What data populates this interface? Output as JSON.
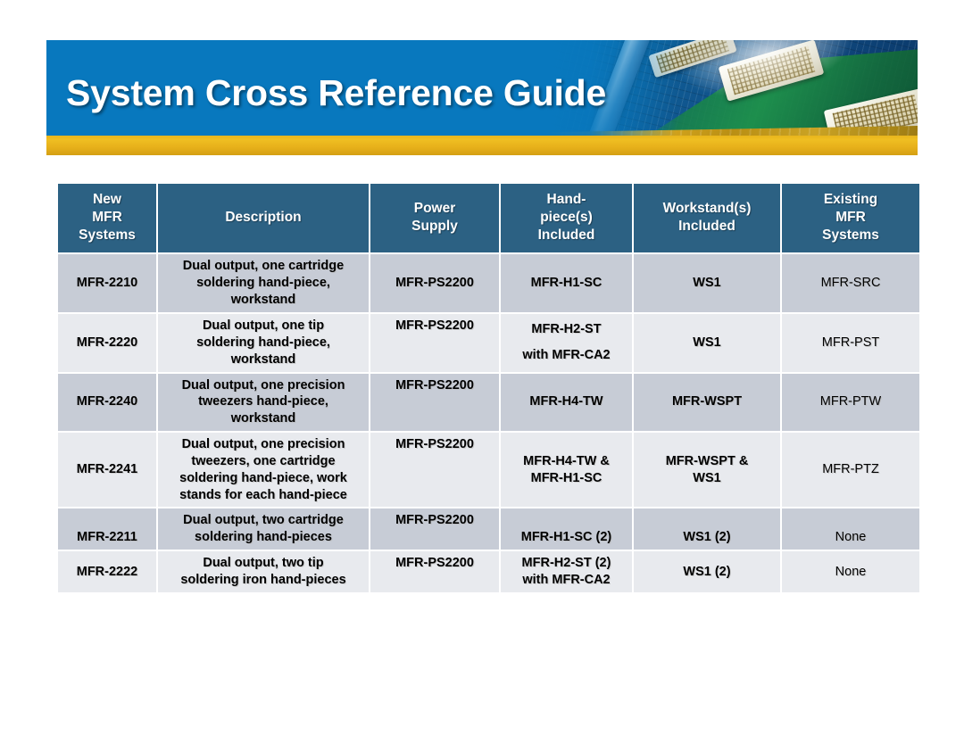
{
  "banner": {
    "title": "System Cross Reference Guide",
    "photo_alt": "circuit-board-soldering-photo",
    "blue": "#0878be",
    "gold": "#e8b51c"
  },
  "table": {
    "header_bg": "#2c6183",
    "row_shade_bg": "#c7ccd6",
    "row_light_bg": "#e8eaee",
    "columns": [
      {
        "id": "new_mfr_systems",
        "lines": [
          "New",
          "MFR",
          "Systems"
        ]
      },
      {
        "id": "description",
        "lines": [
          "Description"
        ]
      },
      {
        "id": "power_supply",
        "lines": [
          "Power",
          "Supply"
        ]
      },
      {
        "id": "hand_pieces_included",
        "lines": [
          "Hand-",
          "piece(s)",
          "Included"
        ]
      },
      {
        "id": "workstands_included",
        "lines": [
          "Workstand(s)",
          "Included"
        ]
      },
      {
        "id": "existing_mfr_systems",
        "lines": [
          "Existing",
          "MFR",
          "Systems"
        ]
      }
    ],
    "rows": [
      {
        "model": "MFR-2210",
        "description": [
          "Dual output, one cartridge",
          "soldering hand-piece,",
          "workstand"
        ],
        "power_supply": [
          "MFR-PS2200"
        ],
        "hand_pieces": [
          "MFR-H1-SC"
        ],
        "workstands": [
          "WS1"
        ],
        "existing": [
          "MFR-SRC"
        ]
      },
      {
        "model": "MFR-2220",
        "description": [
          "Dual output, one tip",
          "soldering hand-piece,",
          "workstand"
        ],
        "power_supply": [
          "MFR-PS2200"
        ],
        "hand_pieces": [
          "MFR-H2-ST",
          "",
          "with MFR-CA2"
        ],
        "workstands": [
          "WS1"
        ],
        "existing": [
          "MFR-PST"
        ]
      },
      {
        "model": "MFR-2240",
        "description": [
          "Dual output, one precision",
          "tweezers hand-piece,",
          "workstand"
        ],
        "power_supply": [
          "MFR-PS2200"
        ],
        "hand_pieces": [
          "MFR-H4-TW"
        ],
        "workstands": [
          "MFR-WSPT"
        ],
        "existing": [
          "MFR-PTW"
        ]
      },
      {
        "model": "MFR-2241",
        "description": [
          "Dual output, one precision",
          "tweezers, one cartridge",
          "soldering hand-piece, work",
          "stands for each hand-piece"
        ],
        "power_supply": [
          "MFR-PS2200"
        ],
        "hand_pieces": [
          "MFR-H4-TW  &",
          "MFR-H1-SC"
        ],
        "workstands": [
          "MFR-WSPT &",
          "WS1"
        ],
        "existing": [
          "MFR-PTZ"
        ]
      },
      {
        "model": "MFR-2211",
        "description": [
          "Dual output, two cartridge",
          "soldering hand-pieces"
        ],
        "power_supply": [
          "MFR-PS2200"
        ],
        "hand_pieces": [
          "MFR-H1-SC (2)"
        ],
        "workstands": [
          "WS1 (2)"
        ],
        "existing": [
          "None"
        ]
      },
      {
        "model": "MFR-2222",
        "description": [
          "Dual output, two tip",
          "soldering iron hand-pieces"
        ],
        "power_supply": [
          "MFR-PS2200"
        ],
        "hand_pieces": [
          "MFR-H2-ST (2)",
          "with MFR-CA2"
        ],
        "workstands": [
          "WS1 (2)"
        ],
        "existing": [
          "None"
        ]
      }
    ]
  }
}
